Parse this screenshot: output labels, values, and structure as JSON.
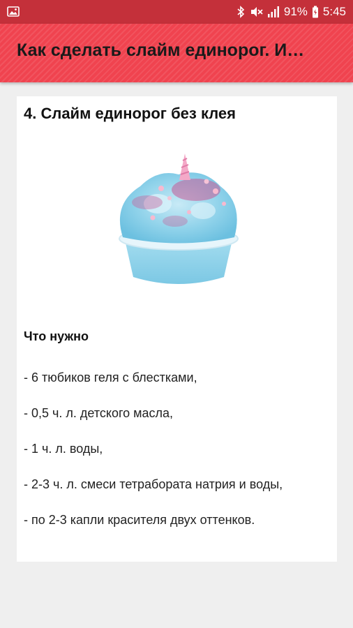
{
  "status_bar": {
    "battery": "91%",
    "time": "5:45",
    "icons": [
      "gallery-icon",
      "bluetooth-icon",
      "mute-icon",
      "signal-icon",
      "battery-icon"
    ],
    "color": "#c4303a"
  },
  "app_bar": {
    "title": "Как сделать слайм единорог. И…",
    "color": "#f0434f"
  },
  "article": {
    "title": "4. Слайм единорог без клея",
    "image": "unicorn-slime-photo",
    "section_heading": "Что нужно",
    "ingredients": [
      "- 6 тюбиков геля с блестками,",
      "- 0,5 ч. л. детского масла,",
      "- 1 ч. л. воды,",
      "- 2-3 ч. л. смеси тетрабората натрия и воды,",
      "- по 2-3 капли красителя двух оттенков."
    ]
  }
}
